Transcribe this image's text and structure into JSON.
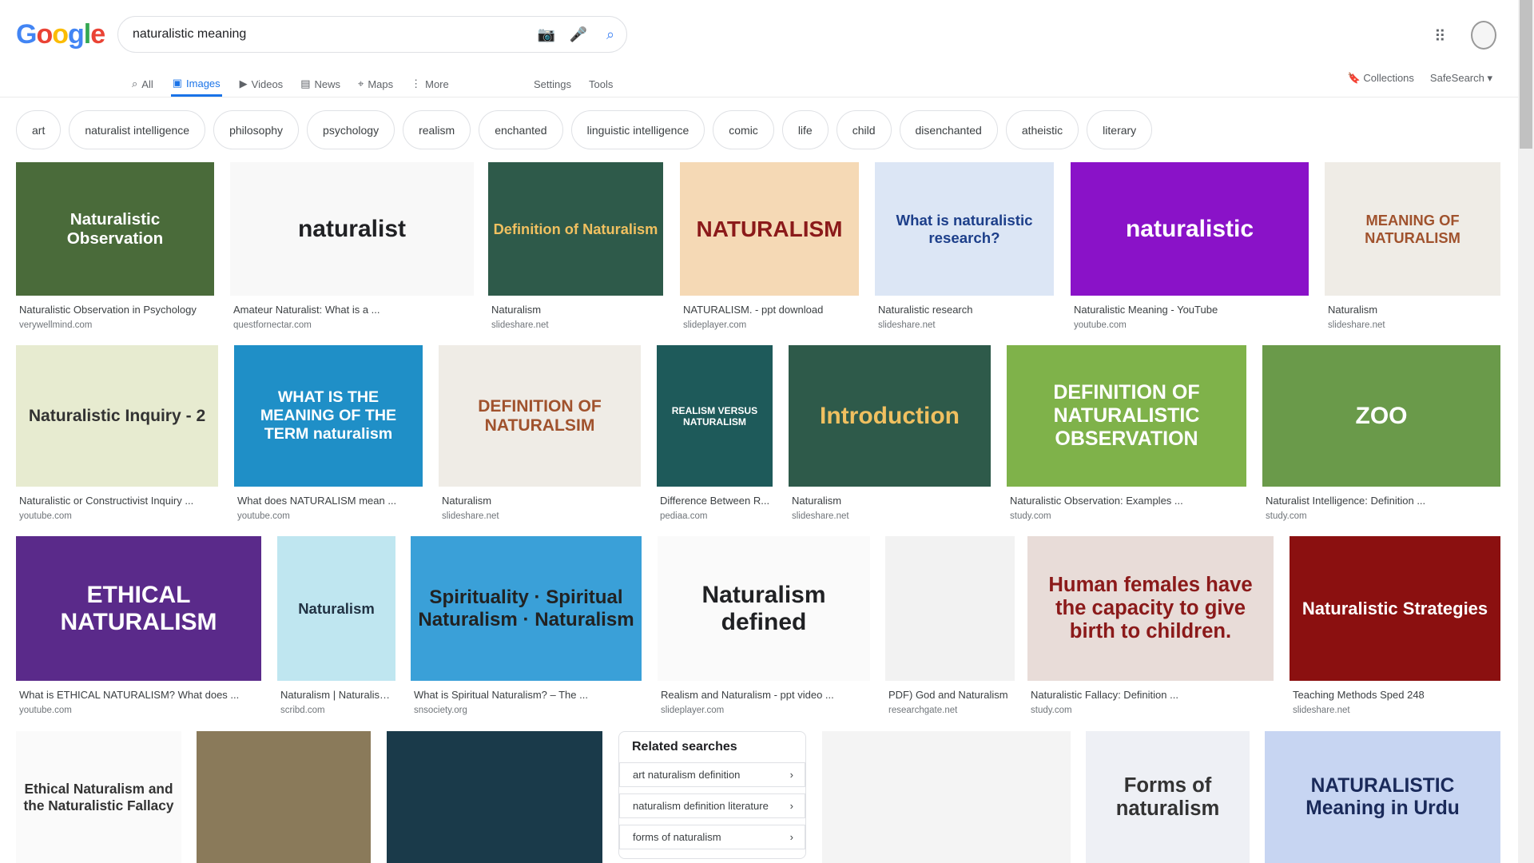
{
  "header": {
    "logo": "Google",
    "query": "naturalistic meaning",
    "tabs": [
      {
        "label": "All",
        "icon": "search-icon"
      },
      {
        "label": "Images",
        "icon": "image-icon"
      },
      {
        "label": "Videos",
        "icon": "play-icon"
      },
      {
        "label": "News",
        "icon": "news-icon"
      },
      {
        "label": "Maps",
        "icon": "map-icon"
      },
      {
        "label": "More",
        "icon": "more-icon"
      }
    ],
    "settings": "Settings",
    "tools": "Tools",
    "collections": "Collections",
    "safesearch": "SafeSearch"
  },
  "chips": [
    "art",
    "naturalist intelligence",
    "philosophy",
    "psychology",
    "realism",
    "enchanted",
    "linguistic intelligence",
    "comic",
    "life",
    "child",
    "disenchanted",
    "atheistic",
    "literary"
  ],
  "results": [
    {
      "thumb": "Naturalistic Observation",
      "title": "Naturalistic Observation in Psychology",
      "source": "verywellmind.com",
      "bg": "#4a6b3a",
      "fg": "#fff"
    },
    {
      "thumb": "naturalist",
      "title": "Amateur Naturalist: What is a ...",
      "source": "questfornectar.com",
      "bg": "#f8f8f8",
      "fg": "#202124"
    },
    {
      "thumb": "Definition of Naturalism",
      "title": "Naturalism",
      "source": "slideshare.net",
      "bg": "#2e5a4a",
      "fg": "#f0c060"
    },
    {
      "thumb": "NATURALISM",
      "title": "NATURALISM. - ppt download",
      "source": "slideplayer.com",
      "bg": "#f5d9b5",
      "fg": "#8b1a1a"
    },
    {
      "thumb": "What is naturalistic research?",
      "title": "Naturalistic research",
      "source": "slideshare.net",
      "bg": "#dce6f5",
      "fg": "#1d3f8a"
    },
    {
      "thumb": "naturalistic",
      "title": "Naturalistic Meaning - YouTube",
      "source": "youtube.com",
      "bg": "#8a12c8",
      "fg": "#fff"
    },
    {
      "thumb": "MEANING OF NATURALISM",
      "title": "Naturalism",
      "source": "slideshare.net",
      "bg": "#efece6",
      "fg": "#a0522d"
    },
    {
      "thumb": "Naturalistic Inquiry - 2",
      "title": "Naturalistic or Constructivist Inquiry ...",
      "source": "youtube.com",
      "bg": "#e7ebd0",
      "fg": "#333"
    },
    {
      "thumb": "WHAT IS THE MEANING OF THE TERM naturalism",
      "title": "What does NATURALISM mean ...",
      "source": "youtube.com",
      "bg": "#1f8fc7",
      "fg": "#fff"
    },
    {
      "thumb": "DEFINITION OF NATURALSIM",
      "title": "Naturalism",
      "source": "slideshare.net",
      "bg": "#efece6",
      "fg": "#a0522d"
    },
    {
      "thumb": "REALISM VERSUS NATURALISM",
      "title": "Difference Between R...",
      "source": "pediaa.com",
      "bg": "#1e5a5a",
      "fg": "#fff"
    },
    {
      "thumb": "Introduction",
      "title": "Naturalism",
      "source": "slideshare.net",
      "bg": "#2e5a4a",
      "fg": "#f0c060"
    },
    {
      "thumb": "DEFINITION OF NATURALISTIC OBSERVATION",
      "title": "Naturalistic Observation: Examples ...",
      "source": "study.com",
      "bg": "#7fb24a",
      "fg": "#fff"
    },
    {
      "thumb": "ZOO",
      "title": "Naturalist Intelligence: Definition ...",
      "source": "study.com",
      "bg": "#6a9a4a",
      "fg": "#fff"
    },
    {
      "thumb": "ETHICAL NATURALISM",
      "title": "What is ETHICAL NATURALISM? What does ...",
      "source": "youtube.com",
      "bg": "#5a2a8a",
      "fg": "#fff"
    },
    {
      "thumb": "Naturalism",
      "title": "Naturalism | Naturalism...",
      "source": "scribd.com",
      "bg": "#bfe6f0",
      "fg": "#234"
    },
    {
      "thumb": "Spirituality · Spiritual Naturalism · Naturalism",
      "title": "What is Spiritual Naturalism? – The ...",
      "source": "snsociety.org",
      "bg": "#3aa0d8",
      "fg": "#222"
    },
    {
      "thumb": "Naturalism defined",
      "title": "Realism and Naturalism - ppt video ...",
      "source": "slideplayer.com",
      "bg": "#fafafa",
      "fg": "#202124"
    },
    {
      "thumb": "",
      "title": "PDF) God and Naturalism",
      "source": "researchgate.net",
      "bg": "#f2f2f2",
      "fg": "#555"
    },
    {
      "thumb": "Human females have the capacity to give birth to children.",
      "title": "Naturalistic Fallacy: Definition ...",
      "source": "study.com",
      "bg": "#e8dcd8",
      "fg": "#8b1a1a"
    },
    {
      "thumb": "Naturalistic Strategies",
      "title": "Teaching Methods Sped 248",
      "source": "slideshare.net",
      "bg": "#8b1010",
      "fg": "#fff"
    },
    {
      "thumb": "Ethical Naturalism and the Naturalistic Fallacy",
      "title": "",
      "source": "",
      "bg": "#fafafa",
      "fg": "#333"
    },
    {
      "thumb": "",
      "title": "",
      "source": "",
      "bg": "#8a7a5a",
      "fg": "#fff"
    },
    {
      "thumb": "",
      "title": "",
      "source": "",
      "bg": "#1a3a4a",
      "fg": "#fff"
    },
    {
      "thumb": "",
      "title": "",
      "source": "",
      "bg": "#f4f4f4",
      "fg": "#222"
    },
    {
      "thumb": "Forms of naturalism",
      "title": "",
      "source": "",
      "bg": "#eef0f5",
      "fg": "#333"
    },
    {
      "thumb": "NATURALISTIC Meaning in Urdu",
      "title": "",
      "source": "",
      "bg": "#c7d5f2",
      "fg": "#1a2a5a"
    }
  ],
  "related": {
    "title": "Related searches",
    "items": [
      "art naturalism definition",
      "naturalism definition literature",
      "forms of naturalism"
    ]
  }
}
